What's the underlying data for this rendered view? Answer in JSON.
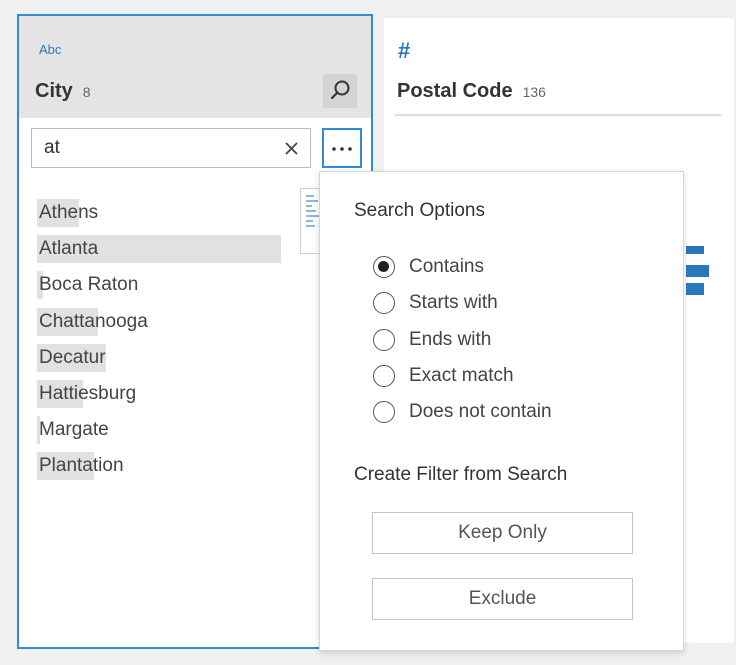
{
  "city_card": {
    "type_label": "Abc",
    "field_name": "City",
    "count": "8",
    "search": {
      "value": "at",
      "placeholder": ""
    },
    "cities": [
      {
        "name": "Athens",
        "highlight": 0.68,
        "selected": false
      },
      {
        "name": "Atlanta",
        "highlight": 1.0,
        "selected": true
      },
      {
        "name": "Boca Raton",
        "highlight": 0.06,
        "selected": false
      },
      {
        "name": "Chattanooga",
        "highlight": 0.55,
        "selected": false
      },
      {
        "name": "Decatur",
        "highlight": 1.0,
        "selected": false
      },
      {
        "name": "Hattiesburg",
        "highlight": 0.46,
        "selected": false
      },
      {
        "name": "Margate",
        "highlight": 0.03,
        "selected": false
      },
      {
        "name": "Plantation",
        "highlight": 0.66,
        "selected": false
      }
    ]
  },
  "postal_card": {
    "type_label": "#",
    "field_name": "Postal Code",
    "count": "136"
  },
  "search_options_popup": {
    "title": "Search Options",
    "options": [
      {
        "label": "Contains",
        "checked": true
      },
      {
        "label": "Starts with",
        "checked": false
      },
      {
        "label": "Ends with",
        "checked": false
      },
      {
        "label": "Exact match",
        "checked": false
      },
      {
        "label": "Does not contain",
        "checked": false
      }
    ],
    "filter_title": "Create Filter from Search",
    "keep_only_label": "Keep Only",
    "exclude_label": "Exclude"
  },
  "colors": {
    "accent": "#2f8dd8",
    "type_icon": "#2b77bf",
    "highlight": "#e1e1e1",
    "header_bg": "#e4e4e4"
  },
  "icons": {
    "search": "magnifier-icon",
    "clear": "close-x-icon",
    "more": "ellipsis-icon"
  }
}
